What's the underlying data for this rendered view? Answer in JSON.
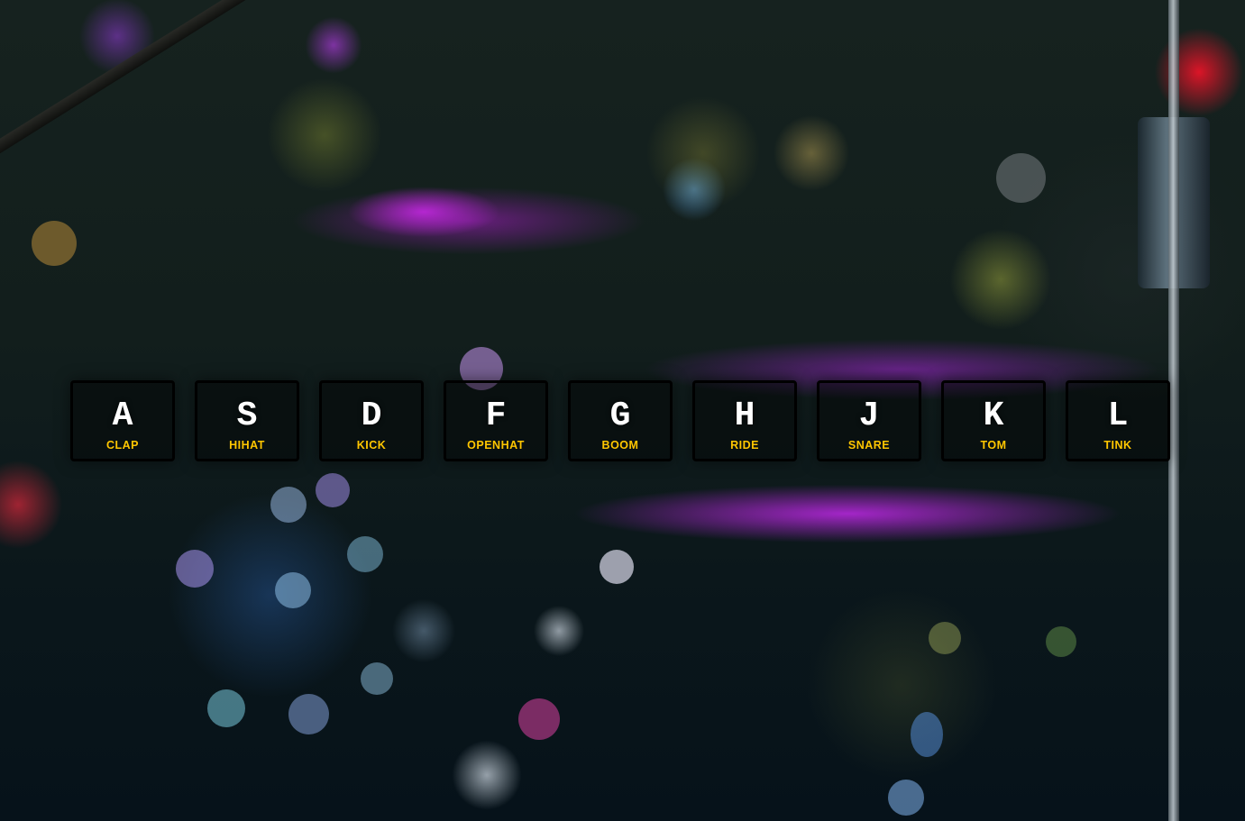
{
  "keys": [
    {
      "letter": "A",
      "sound": "CLAP"
    },
    {
      "letter": "S",
      "sound": "HIHAT"
    },
    {
      "letter": "D",
      "sound": "KICK"
    },
    {
      "letter": "F",
      "sound": "OPENHAT"
    },
    {
      "letter": "G",
      "sound": "BOOM"
    },
    {
      "letter": "H",
      "sound": "RIDE"
    },
    {
      "letter": "J",
      "sound": "SNARE"
    },
    {
      "letter": "K",
      "sound": "TOM"
    },
    {
      "letter": "L",
      "sound": "TINK"
    }
  ],
  "colors": {
    "sound_label": "#ffc600",
    "key_letter": "#ffffff",
    "key_border": "#000000"
  }
}
